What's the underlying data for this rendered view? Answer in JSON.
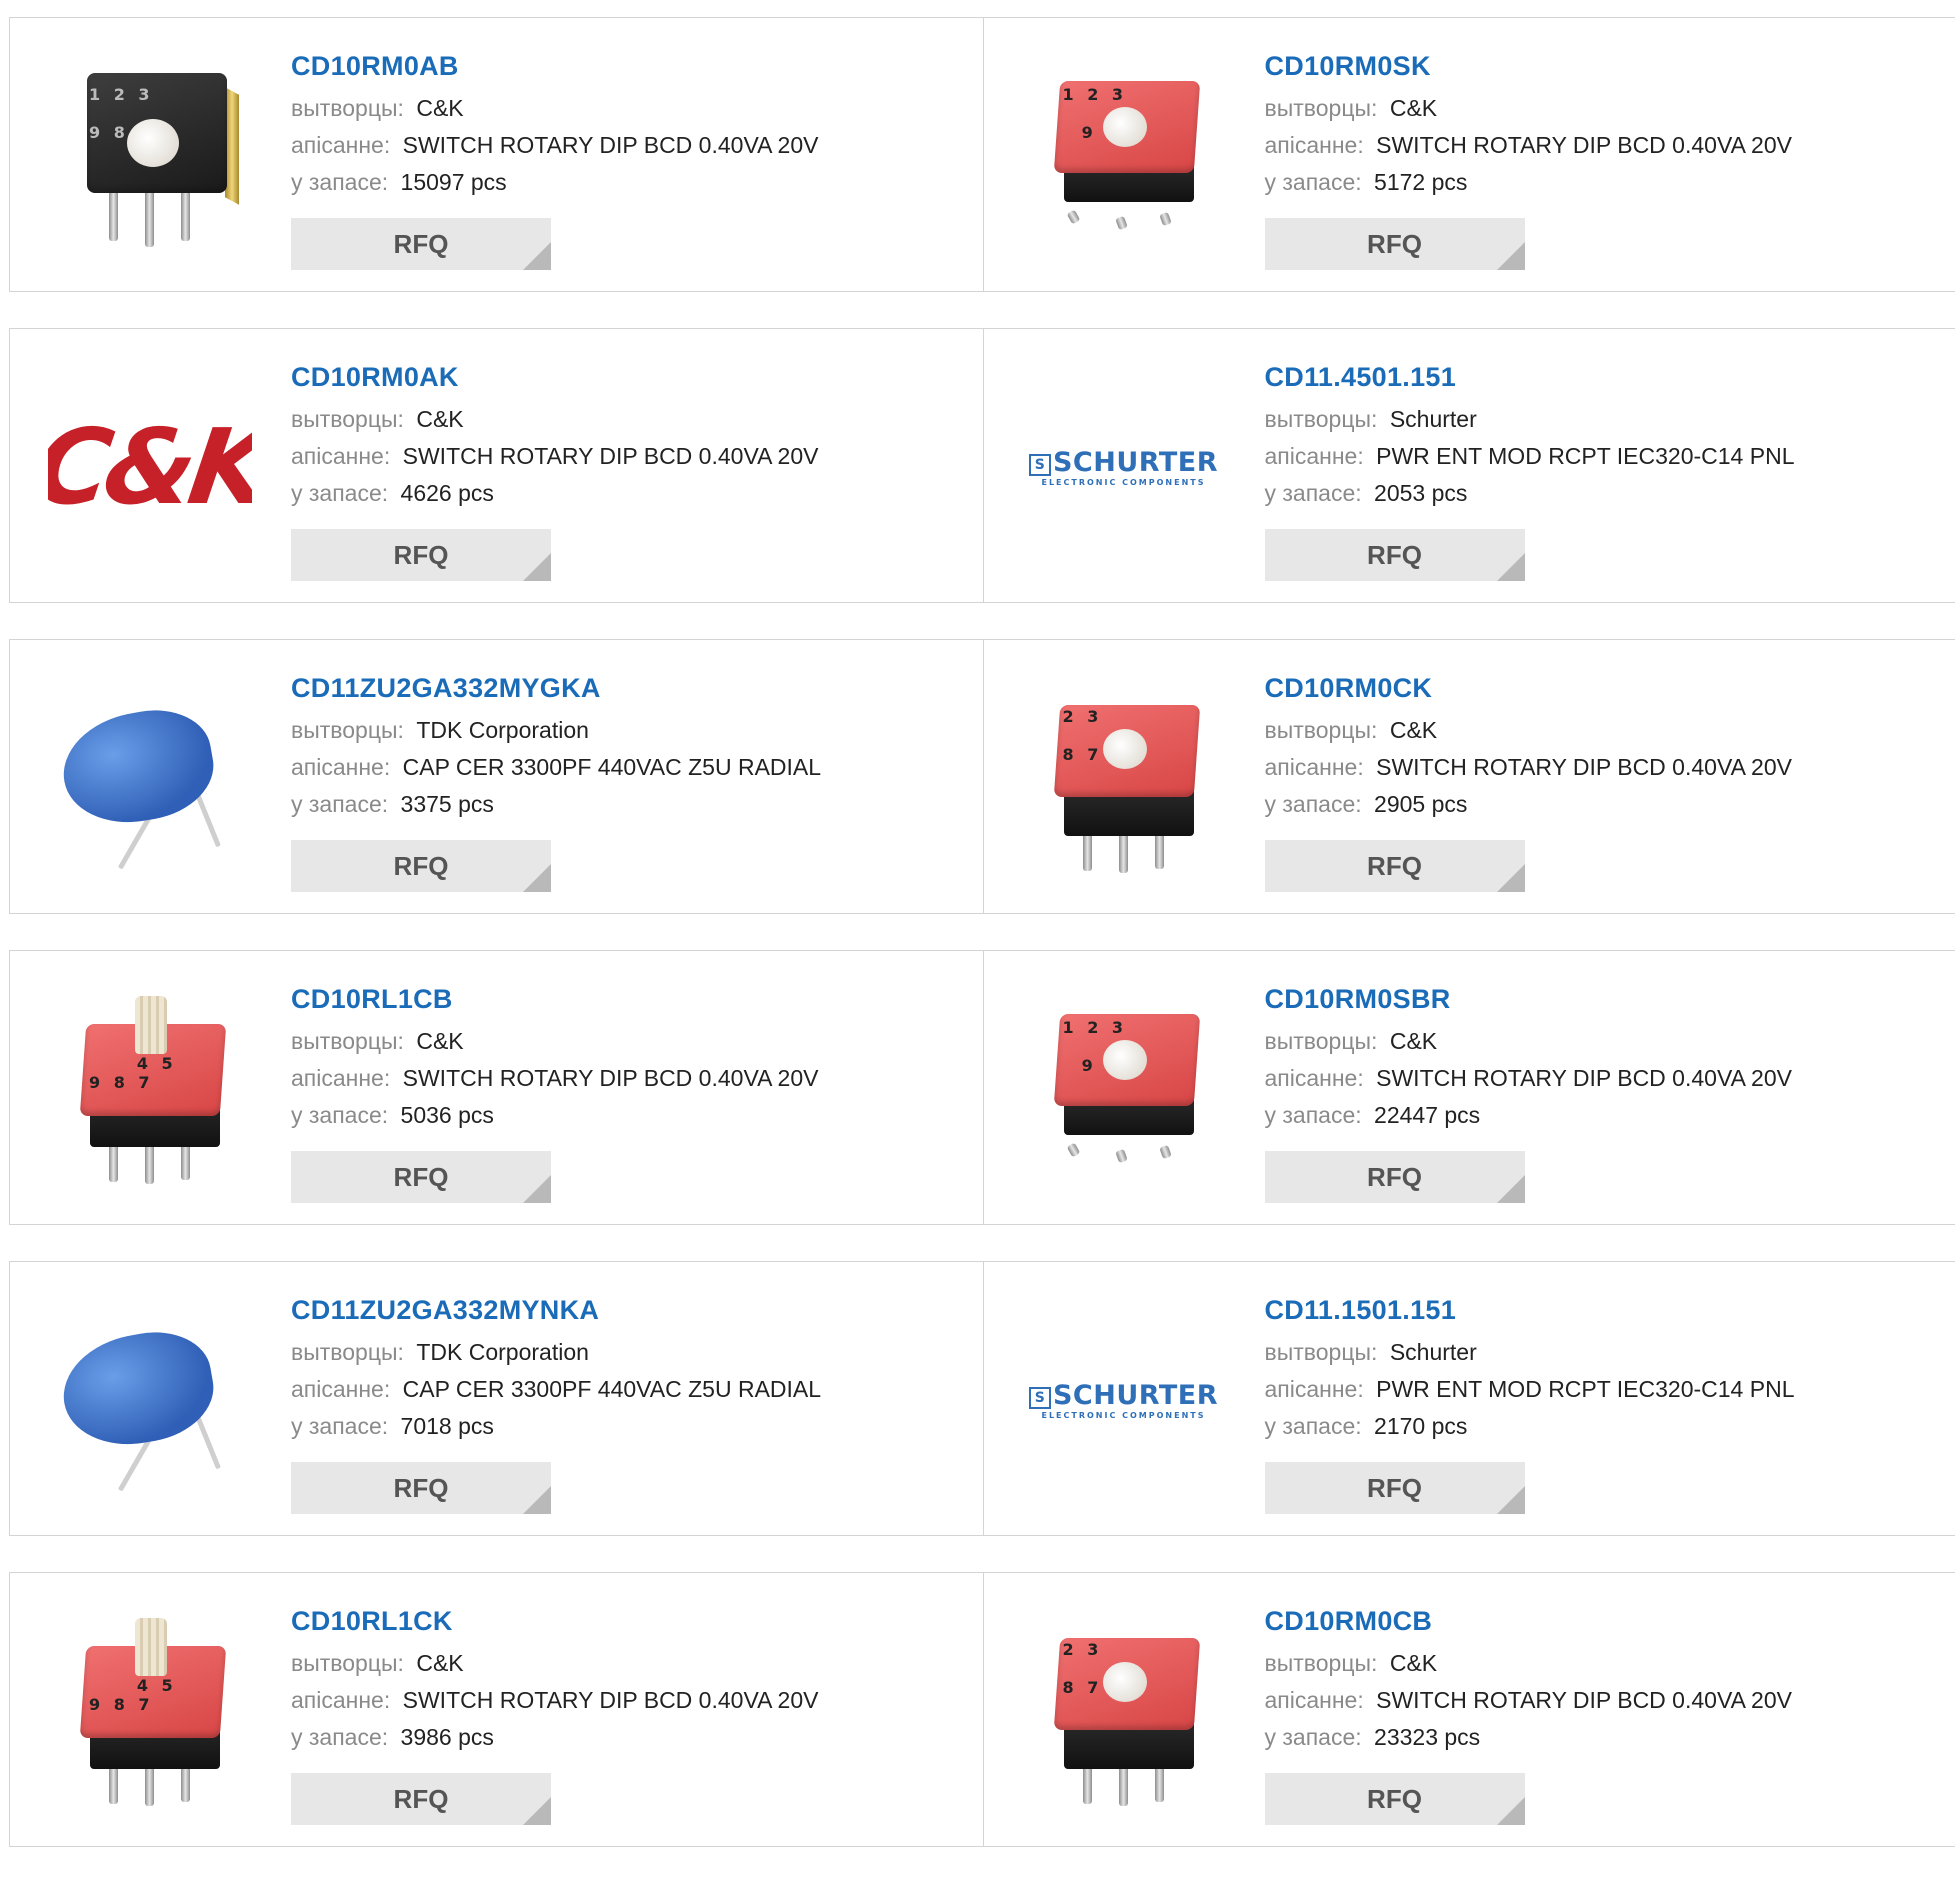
{
  "labels": {
    "manufacturer": "вытворцы:",
    "description": "апісанне:",
    "stock": "у запасе:",
    "rfq": "RFQ"
  },
  "logos": {
    "ck": "C&K",
    "schurter": "SCHURTER",
    "schurter_sub": "ELECTRONIC COMPONENTS"
  },
  "products": [
    {
      "part": "CD10RM0AB",
      "manufacturer": "C&K",
      "description": "SWITCH ROTARY DIP BCD 0.40VA 20V",
      "stock": "15097 pcs",
      "image": "black-rotary-switch"
    },
    {
      "part": "CD10RM0SK",
      "manufacturer": "C&K",
      "description": "SWITCH ROTARY DIP BCD 0.40VA 20V",
      "stock": "5172 pcs",
      "image": "red-rotary-switch-smd"
    },
    {
      "part": "CD10RM0AK",
      "manufacturer": "C&K",
      "description": "SWITCH ROTARY DIP BCD 0.40VA 20V",
      "stock": "4626 pcs",
      "image": "ck-logo"
    },
    {
      "part": "CD11.4501.151",
      "manufacturer": "Schurter",
      "description": "PWR ENT MOD RCPT IEC320-C14 PNL",
      "stock": "2053 pcs",
      "image": "schurter-logo"
    },
    {
      "part": "CD11ZU2GA332MYGKA",
      "manufacturer": "TDK Corporation",
      "description": "CAP CER 3300PF 440VAC Z5U RADIAL",
      "stock": "3375 pcs",
      "image": "blue-ceramic-capacitor"
    },
    {
      "part": "CD10RM0CK",
      "manufacturer": "C&K",
      "description": "SWITCH ROTARY DIP BCD 0.40VA 20V",
      "stock": "2905 pcs",
      "image": "red-rotary-switch-tht"
    },
    {
      "part": "CD10RL1CB",
      "manufacturer": "C&K",
      "description": "SWITCH ROTARY DIP BCD 0.40VA 20V",
      "stock": "5036 pcs",
      "image": "red-rotary-switch-shaft"
    },
    {
      "part": "CD10RM0SBR",
      "manufacturer": "C&K",
      "description": "SWITCH ROTARY DIP BCD 0.40VA 20V",
      "stock": "22447 pcs",
      "image": "red-rotary-switch-smd"
    },
    {
      "part": "CD11ZU2GA332MYNKA",
      "manufacturer": "TDK Corporation",
      "description": "CAP CER 3300PF 440VAC Z5U RADIAL",
      "stock": "7018 pcs",
      "image": "blue-ceramic-capacitor"
    },
    {
      "part": "CD11.1501.151",
      "manufacturer": "Schurter",
      "description": "PWR ENT MOD RCPT IEC320-C14 PNL",
      "stock": "2170 pcs",
      "image": "schurter-logo"
    },
    {
      "part": "CD10RL1CK",
      "manufacturer": "C&K",
      "description": "SWITCH ROTARY DIP BCD 0.40VA 20V",
      "stock": "3986 pcs",
      "image": "red-rotary-switch-shaft"
    },
    {
      "part": "CD10RM0CB",
      "manufacturer": "C&K",
      "description": "SWITCH ROTARY DIP BCD 0.40VA 20V",
      "stock": "23323 pcs",
      "image": "red-rotary-switch-tht"
    }
  ],
  "colors": {
    "part_link": "#1a6bb8",
    "label": "#8a8a8a",
    "rfq_bg": "#e7e7e7",
    "border": "#d4d4d4",
    "ck_red": "#c62128",
    "schurter_blue": "#2e6fb8"
  }
}
